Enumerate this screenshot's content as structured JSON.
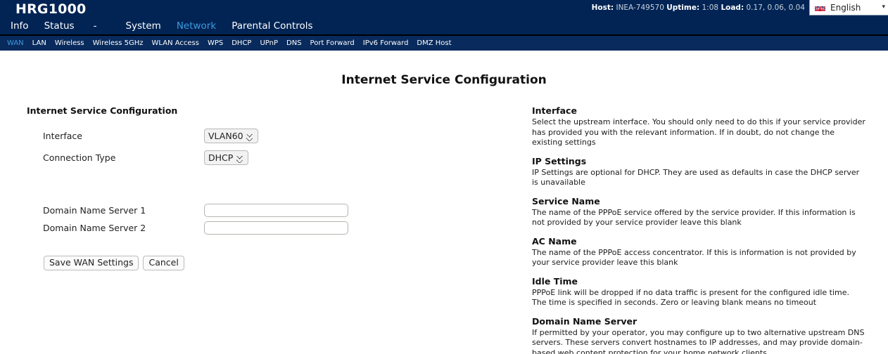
{
  "brand": {
    "logo": "HRG1000",
    "host_label": "Host:",
    "host_value": "INEA-749570",
    "uptime_label": "Uptime:",
    "uptime_value": "1:08",
    "load_label": "Load:",
    "load_value": "0.17, 0.06, 0.04",
    "language": "English",
    "language_icon": "uk-flag-icon",
    "chevron_icon": "chevron-down-icon"
  },
  "colors": {
    "navbar_bg": "#012454",
    "subnav_bg": "#082a5c",
    "active_link": "#3d9adf",
    "link": "#ffffff"
  },
  "mainnav": [
    {
      "label": "Info",
      "active": false
    },
    {
      "label": "Status",
      "active": false
    },
    {
      "label": "-",
      "active": false
    },
    {
      "label": "System",
      "active": false
    },
    {
      "label": "Network",
      "active": true
    },
    {
      "label": "Parental Controls",
      "active": false
    }
  ],
  "subnav": [
    {
      "label": "WAN",
      "active": true
    },
    {
      "label": "LAN",
      "active": false
    },
    {
      "label": "Wireless",
      "active": false
    },
    {
      "label": "Wireless 5GHz",
      "active": false
    },
    {
      "label": "WLAN Access",
      "active": false
    },
    {
      "label": "WPS",
      "active": false
    },
    {
      "label": "DHCP",
      "active": false
    },
    {
      "label": "UPnP",
      "active": false
    },
    {
      "label": "DNS",
      "active": false
    },
    {
      "label": "Port Forward",
      "active": false
    },
    {
      "label": "IPv6 Forward",
      "active": false
    },
    {
      "label": "DMZ Host",
      "active": false
    }
  ],
  "page": {
    "title": "Internet Service Configuration",
    "section_heading": "Internet Service Configuration"
  },
  "form": {
    "interface_label": "Interface",
    "interface_value": "VLAN60",
    "interface_options": [
      "VLAN60"
    ],
    "connection_type_label": "Connection Type",
    "connection_type_value": "DHCP",
    "connection_type_options": [
      "DHCP"
    ],
    "dns1_label": "Domain Name Server 1",
    "dns1_value": "",
    "dns1_placeholder": "",
    "dns2_label": "Domain Name Server 2",
    "dns2_value": "",
    "dns2_placeholder": "",
    "save_label": "Save WAN Settings",
    "cancel_label": "Cancel"
  },
  "help": [
    {
      "title": "Interface",
      "body": "Select the upstream interface. You should only need to do this if your service provider has provided you with the relevant information. If in doubt, do not change the existing settings"
    },
    {
      "title": "IP Settings",
      "body": "IP Settings are optional for DHCP. They are used as defaults in case the DHCP server is unavailable"
    },
    {
      "title": "Service Name",
      "body": "The name of the PPPoE service offered by the service provider. If this information is not provided by your service provider leave this blank"
    },
    {
      "title": "AC Name",
      "body": "The name of the PPPoE access concentrator. If this is information is not provided by your service provider leave this blank"
    },
    {
      "title": "Idle Time",
      "body": "PPPoE link will be dropped if no data traffic is present for the configured idle time. The time is specified in seconds. Zero or leaving blank means no timeout"
    },
    {
      "title": "Domain Name Server",
      "body": "If permitted by your operator, you may configure up to two alternative upstream DNS servers. These servers convert hostnames to IP addresses, and may provide domain-based web content protection for your home network clients"
    }
  ]
}
